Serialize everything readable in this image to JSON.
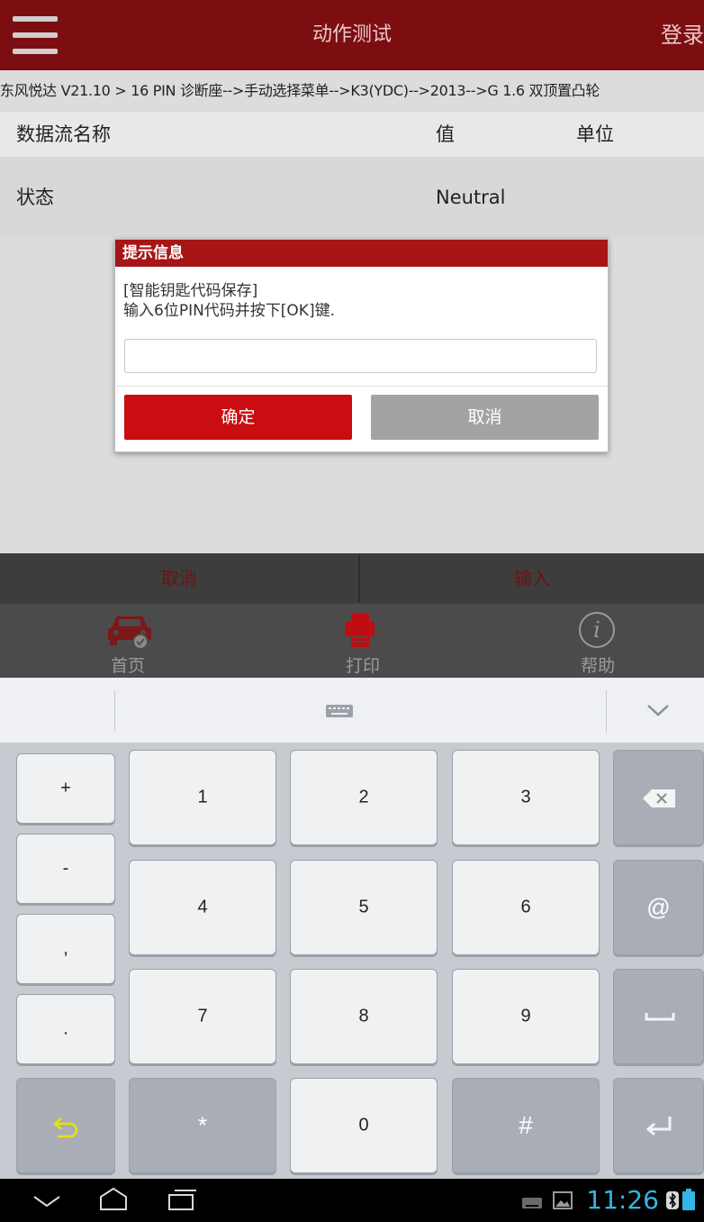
{
  "topbar": {
    "title": "动作测试",
    "login": "登录"
  },
  "breadcrumb": "东风悦达 V21.10 > 16 PIN 诊断座-->手动选择菜单-->K3(YDC)-->2013-->G 1.6 双顶置凸轮",
  "table": {
    "headers": {
      "name": "数据流名称",
      "value": "值",
      "unit": "单位"
    },
    "rows": [
      {
        "name": "状态",
        "value": "Neutral",
        "unit": ""
      }
    ]
  },
  "dialog": {
    "title": "提示信息",
    "line1": "[智能钥匙代码保存]",
    "line2": "输入6位PIN代码并按下[OK]键.",
    "input_value": "",
    "ok": "确定",
    "cancel": "取消"
  },
  "action_bar": {
    "cancel": "取消",
    "input": "输入"
  },
  "nav": {
    "home": "首页",
    "print": "打印",
    "help": "帮助"
  },
  "keyboard": {
    "side": [
      "+",
      "-",
      ",",
      "."
    ],
    "digits": [
      "1",
      "2",
      "3",
      "4",
      "5",
      "6",
      "7",
      "8",
      "9",
      "*",
      "0",
      "#"
    ],
    "at": "@"
  },
  "status": {
    "time": "11:26"
  },
  "colors": {
    "brand_red": "#a81516",
    "top_bar": "#7c0e12",
    "clock": "#33b5e5"
  }
}
